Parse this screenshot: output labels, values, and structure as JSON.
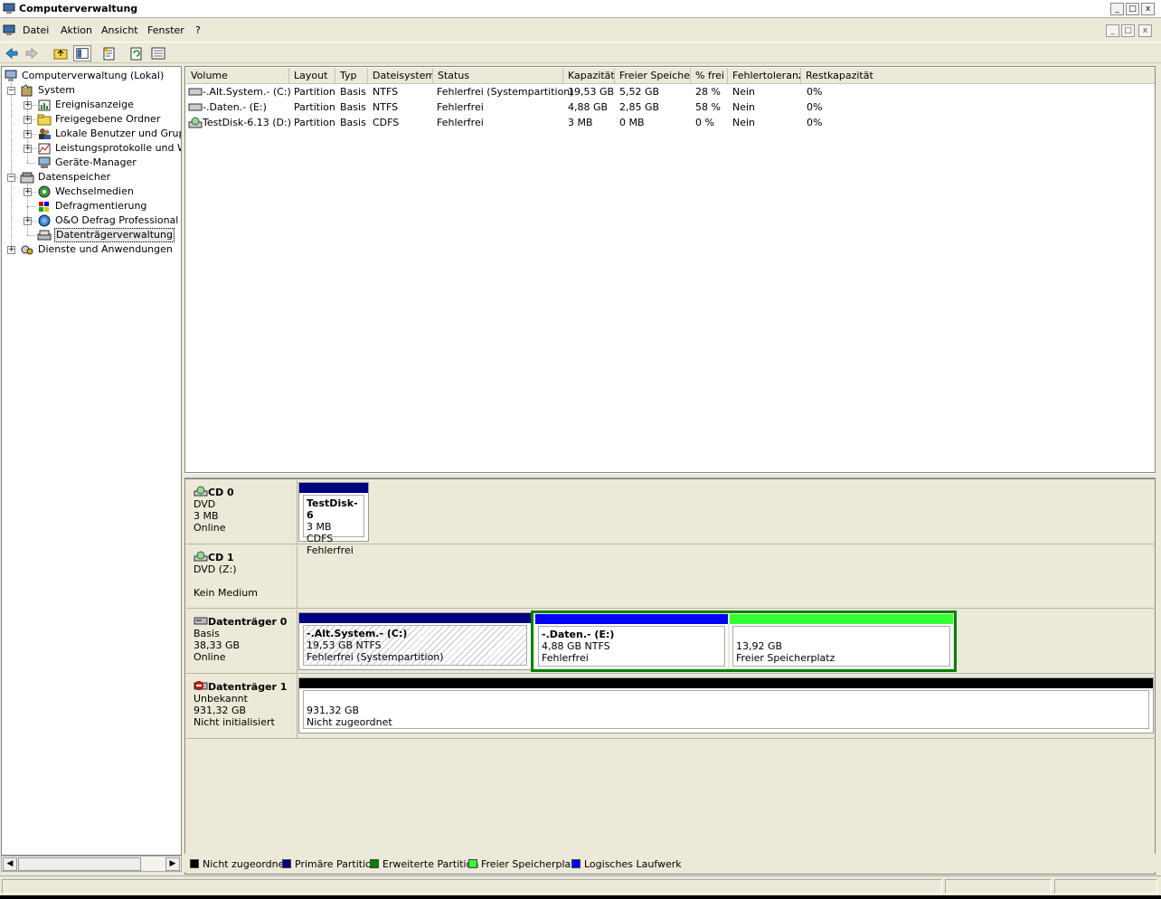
{
  "window": {
    "title": "Computerverwaltung",
    "buttons": [
      "_",
      "□",
      "x"
    ]
  },
  "menu": {
    "items": [
      "Datei",
      "Aktion",
      "Ansicht",
      "Fenster",
      "?"
    ]
  },
  "toolbar": {
    "tools": [
      "back-arrow-icon",
      "forward-arrow-icon",
      "up-folder-icon",
      "show-hide-tree-icon",
      "properties-icon",
      "refresh-icon",
      "help-icon"
    ]
  },
  "tree": {
    "root": "Computerverwaltung (Lokal)",
    "system": "System",
    "ereignisanzeige": "Ereignisanzeige",
    "freigegebene": "Freigegebene Ordner",
    "lokale": "Lokale Benutzer und Gruppen",
    "leistung": "Leistungsprotokolle und Warnungen",
    "geraete": "Geräte-Manager",
    "datenspeicher": "Datenspeicher",
    "wechselmedien": "Wechselmedien",
    "defrag": "Defragmentierung",
    "oo": "O&O Defrag Professional Edition",
    "datentraeger": "Datenträgerverwaltung",
    "dienste": "Dienste und Anwendungen"
  },
  "volumes": {
    "headers": [
      "Volume",
      "Layout",
      "Typ",
      "Dateisystem",
      "Status",
      "Kapazität",
      "Freier Speicher",
      "% frei",
      "Fehlertoleranz",
      "Restkapazität"
    ],
    "rows": [
      [
        "-.Alt.System.- (C:)",
        "Partition",
        "Basis",
        "NTFS",
        "Fehlerfrei (Systempartition)",
        "19,53 GB",
        "5,52 GB",
        "28 %",
        "Nein",
        "0%"
      ],
      [
        "-.Daten.- (E:)",
        "Partition",
        "Basis",
        "NTFS",
        "Fehlerfrei",
        "4,88 GB",
        "2,85 GB",
        "58 %",
        "Nein",
        "0%"
      ],
      [
        "TestDisk-6.13 (D:)",
        "Partition",
        "Basis",
        "CDFS",
        "Fehlerfrei",
        "3 MB",
        "0 MB",
        "0 %",
        "Nein",
        "0%"
      ]
    ]
  },
  "disks": {
    "cd0": {
      "name": "CD 0",
      "line1": "DVD",
      "line2": "3 MB",
      "line3": "Online",
      "part": {
        "name": "TestDisk-6",
        "info": "3 MB CDFS",
        "status": "Fehlerfrei"
      }
    },
    "cd1": {
      "name": "CD 1",
      "line1": "DVD (Z:)",
      "line2": "",
      "line3": "Kein Medium"
    },
    "d0": {
      "name": "Datenträger 0",
      "line1": "Basis",
      "line2": "38,33 GB",
      "line3": "Online",
      "p1": {
        "name": "-.Alt.System.-  (C:)",
        "info": "19,53 GB NTFS",
        "status": "Fehlerfrei (Systempartition)"
      },
      "p2": {
        "name": "-.Daten.-  (E:)",
        "info": "4,88 GB NTFS",
        "status": "Fehlerfrei"
      },
      "p3": {
        "info": "13,92 GB",
        "status": "Freier Speicherplatz"
      }
    },
    "d1": {
      "name": "Datenträger 1",
      "line1": "Unbekannt",
      "line2": "931,32 GB",
      "line3": "Nicht initialisiert",
      "p1": {
        "info": "931,32 GB",
        "status": "Nicht zugeordnet"
      }
    }
  },
  "legend": {
    "items": [
      {
        "label": "Nicht zugeordnet",
        "color": "#000000"
      },
      {
        "label": "Primäre Partition",
        "color": "#000080"
      },
      {
        "label": "Erweiterte Partition",
        "color": "#008000"
      },
      {
        "label": "Freier Speicherplatz",
        "color": "#33ff33"
      },
      {
        "label": "Logisches Laufwerk",
        "color": "#0000ff"
      }
    ]
  },
  "colors": {
    "primary": "#000080",
    "logical": "#0000ff",
    "extended": "#008000",
    "free": "#33ff33",
    "unallocated": "#000000"
  }
}
